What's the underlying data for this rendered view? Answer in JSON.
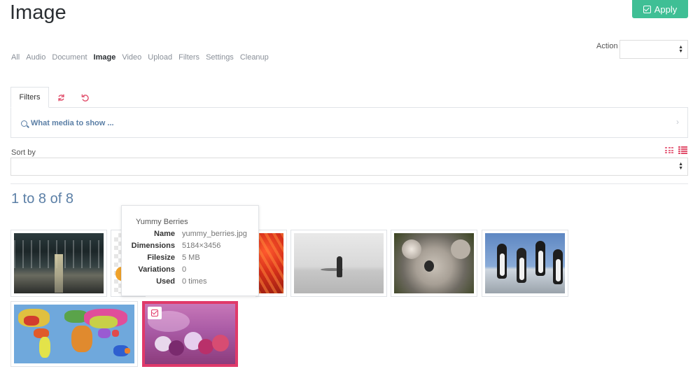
{
  "page": {
    "title": "Image"
  },
  "toolbar": {
    "apply_label": "Apply"
  },
  "nav": {
    "items": [
      "All",
      "Audio",
      "Document",
      "Image",
      "Video",
      "Upload",
      "Filters",
      "Settings",
      "Cleanup"
    ],
    "active": "Image"
  },
  "action": {
    "label": "Action",
    "value": ""
  },
  "filters": {
    "tab_label": "Filters",
    "what_media_label": "What media to show ..."
  },
  "sort": {
    "label": "Sort by",
    "value": ""
  },
  "results": {
    "count_text": "1 to 8 of 8"
  },
  "tooltip": {
    "title": "Yummy Berries",
    "fields": [
      {
        "label": "Name",
        "value": "yummy_berries.jpg"
      },
      {
        "label": "Dimensions",
        "value": "5184×3456"
      },
      {
        "label": "Filesize",
        "value": "5 MB"
      },
      {
        "label": "Variations",
        "value": "0"
      },
      {
        "label": "Used",
        "value": "0 times"
      }
    ]
  },
  "colors": {
    "accent": "#e0396a",
    "apply": "#3fbf95",
    "link": "#5b7fa6"
  },
  "icons": {
    "apply": "check-square-icon",
    "refresh": "refresh-icon",
    "undo": "undo-icon",
    "search": "magnifier-icon",
    "chevron": "chevron-right-icon",
    "grid_view": "grid-view-icon",
    "list_view": "list-view-icon"
  }
}
